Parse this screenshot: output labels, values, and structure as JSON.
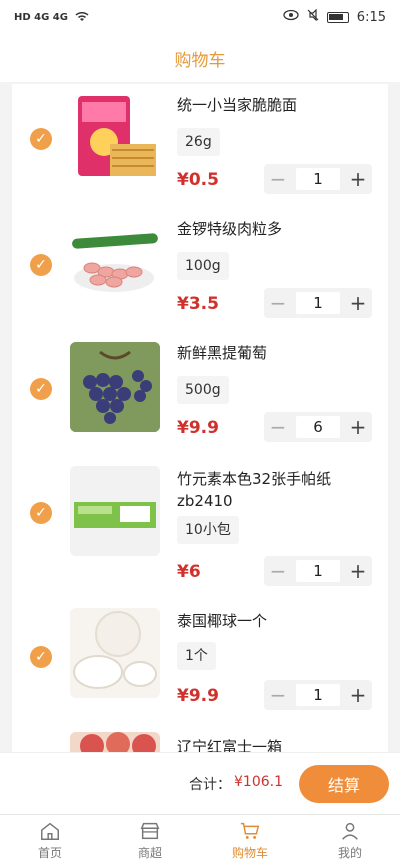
{
  "status_bar": {
    "left_text": "HD 4G 4G",
    "time": "6:15"
  },
  "header": {
    "title": "购物车"
  },
  "items": [
    {
      "name": "统一小当家脆脆面",
      "spec": "26g",
      "price": "¥0.5",
      "qty": "1",
      "checked": true
    },
    {
      "name": "金锣特级肉粒多",
      "spec": "100g",
      "price": "¥3.5",
      "qty": "1",
      "checked": true
    },
    {
      "name": "新鲜黑提葡萄",
      "spec": "500g",
      "price": "¥9.9",
      "qty": "6",
      "checked": true
    },
    {
      "name": "竹元素本色32张手帕纸zb2410",
      "spec": "10小包",
      "price": "¥6",
      "qty": "1",
      "checked": true
    },
    {
      "name": "泰国椰球一个",
      "spec": "1个",
      "price": "¥9.9",
      "qty": "1",
      "checked": true
    },
    {
      "name": "辽宁红富士一箱",
      "spec": "",
      "price": "",
      "qty": "",
      "checked": true
    }
  ],
  "stepper": {
    "minus": "−",
    "plus": "+"
  },
  "footer": {
    "total_label": "合计：",
    "total_value": "¥106.1",
    "checkout_label": "结算"
  },
  "tabs": [
    {
      "label": "首页",
      "icon": "home-icon"
    },
    {
      "label": "商超",
      "icon": "store-icon"
    },
    {
      "label": "购物车",
      "icon": "cart-icon"
    },
    {
      "label": "我的",
      "icon": "user-icon"
    }
  ],
  "colors": {
    "accent": "#f08d3a",
    "price": "#d0312d",
    "title": "#e69a3a"
  }
}
